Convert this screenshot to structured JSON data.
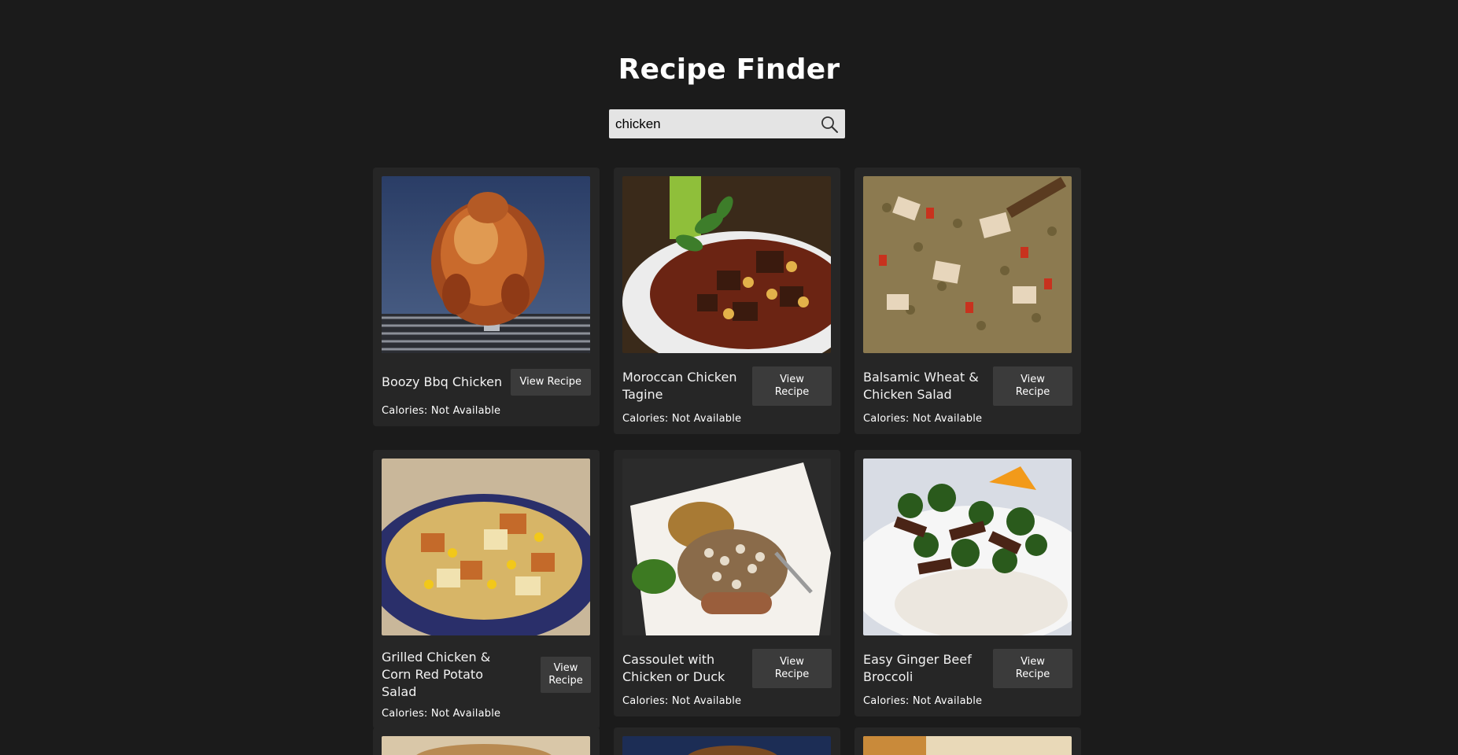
{
  "header": {
    "title": "Recipe Finder"
  },
  "search": {
    "value": "chicken",
    "placeholder": ""
  },
  "recipes": [
    {
      "title": "Boozy Bbq Chicken",
      "button": "View Recipe",
      "calories_label": "Calories:",
      "calories_value": "Not Available",
      "image": "roast-chicken-photo"
    },
    {
      "title": "Moroccan Chicken Tagine",
      "button": "View Recipe",
      "calories_label": "Calories:",
      "calories_value": "Not Available",
      "image": "tagine-photo"
    },
    {
      "title": "Balsamic Wheat & Chicken Salad",
      "button": "View Recipe",
      "calories_label": "Calories:",
      "calories_value": "Not Available",
      "image": "wheat-salad-photo"
    },
    {
      "title": "Grilled Chicken & Corn Red Potato Salad",
      "button": "View Recipe",
      "calories_label": "Calories:",
      "calories_value": "Not Available",
      "image": "potato-salad-photo"
    },
    {
      "title": "Cassoulet with Chicken or Duck",
      "button": "View Recipe",
      "calories_label": "Calories:",
      "calories_value": "Not Available",
      "image": "cassoulet-photo"
    },
    {
      "title": "Easy Ginger Beef Broccoli",
      "button": "View Recipe",
      "calories_label": "Calories:",
      "calories_value": "Not Available",
      "image": "beef-broccoli-photo"
    }
  ],
  "colors": {
    "background": "#1b1b1b",
    "card": "#262626",
    "button": "#3b3b3b",
    "search_bg": "#e4e4e4"
  },
  "icons": {
    "search": "search-icon"
  }
}
